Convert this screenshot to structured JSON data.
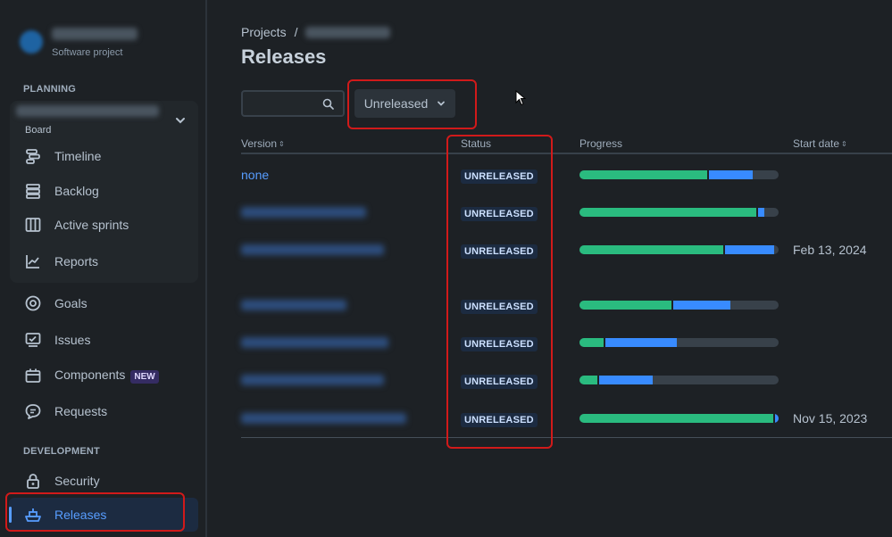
{
  "sidebar": {
    "project_type": "Software project",
    "planning_title": "PLANNING",
    "board_label": "Board",
    "planning_items": [
      {
        "label": "Timeline",
        "icon": "timeline-icon"
      },
      {
        "label": "Backlog",
        "icon": "backlog-icon"
      },
      {
        "label": "Active sprints",
        "icon": "active-sprints-icon"
      },
      {
        "label": "Reports",
        "icon": "reports-icon"
      }
    ],
    "other_items": [
      {
        "label": "Goals",
        "icon": "goals-icon"
      },
      {
        "label": "Issues",
        "icon": "issues-icon"
      },
      {
        "label": "Components",
        "icon": "components-icon",
        "badge": "NEW"
      },
      {
        "label": "Requests",
        "icon": "requests-icon"
      }
    ],
    "development_title": "DEVELOPMENT",
    "development_items": [
      {
        "label": "Security",
        "icon": "lock-icon"
      },
      {
        "label": "Releases",
        "icon": "ship-icon",
        "active": true
      }
    ]
  },
  "header": {
    "breadcrumb_root": "Projects",
    "breadcrumb_sep": "/",
    "title": "Releases"
  },
  "toolbar": {
    "search_placeholder": "",
    "filter_label": "Unreleased"
  },
  "table": {
    "columns": [
      "Version",
      "Status",
      "Progress",
      "Start date"
    ],
    "rows": [
      {
        "version": "none",
        "status": "UNRELEASED",
        "progress_done": 0.64,
        "progress_in_progress": 0.22,
        "start_date": ""
      },
      {
        "version": "",
        "status": "UNRELEASED",
        "progress_done": 0.89,
        "progress_in_progress": 0.03,
        "start_date": ""
      },
      {
        "version": "",
        "status": "UNRELEASED",
        "progress_done": 0.72,
        "progress_in_progress": 0.25,
        "start_date": "Feb 13, 2024"
      },
      {
        "version": "",
        "status": "UNRELEASED",
        "progress_done": 0.46,
        "progress_in_progress": 0.29,
        "start_date": ""
      },
      {
        "version": "",
        "status": "UNRELEASED",
        "progress_done": 0.12,
        "progress_in_progress": 0.36,
        "start_date": ""
      },
      {
        "version": "",
        "status": "UNRELEASED",
        "progress_done": 0.09,
        "progress_in_progress": 0.27,
        "start_date": ""
      },
      {
        "version": "",
        "status": "UNRELEASED",
        "progress_done": 0.98,
        "progress_in_progress": 0.02,
        "start_date": "Nov 15, 2023"
      }
    ]
  },
  "colors": {
    "done": "#2abb7f",
    "in_progress": "#388bff",
    "todo": "#38414a",
    "accent": "#579dff",
    "annotation": "#d11a1a"
  }
}
